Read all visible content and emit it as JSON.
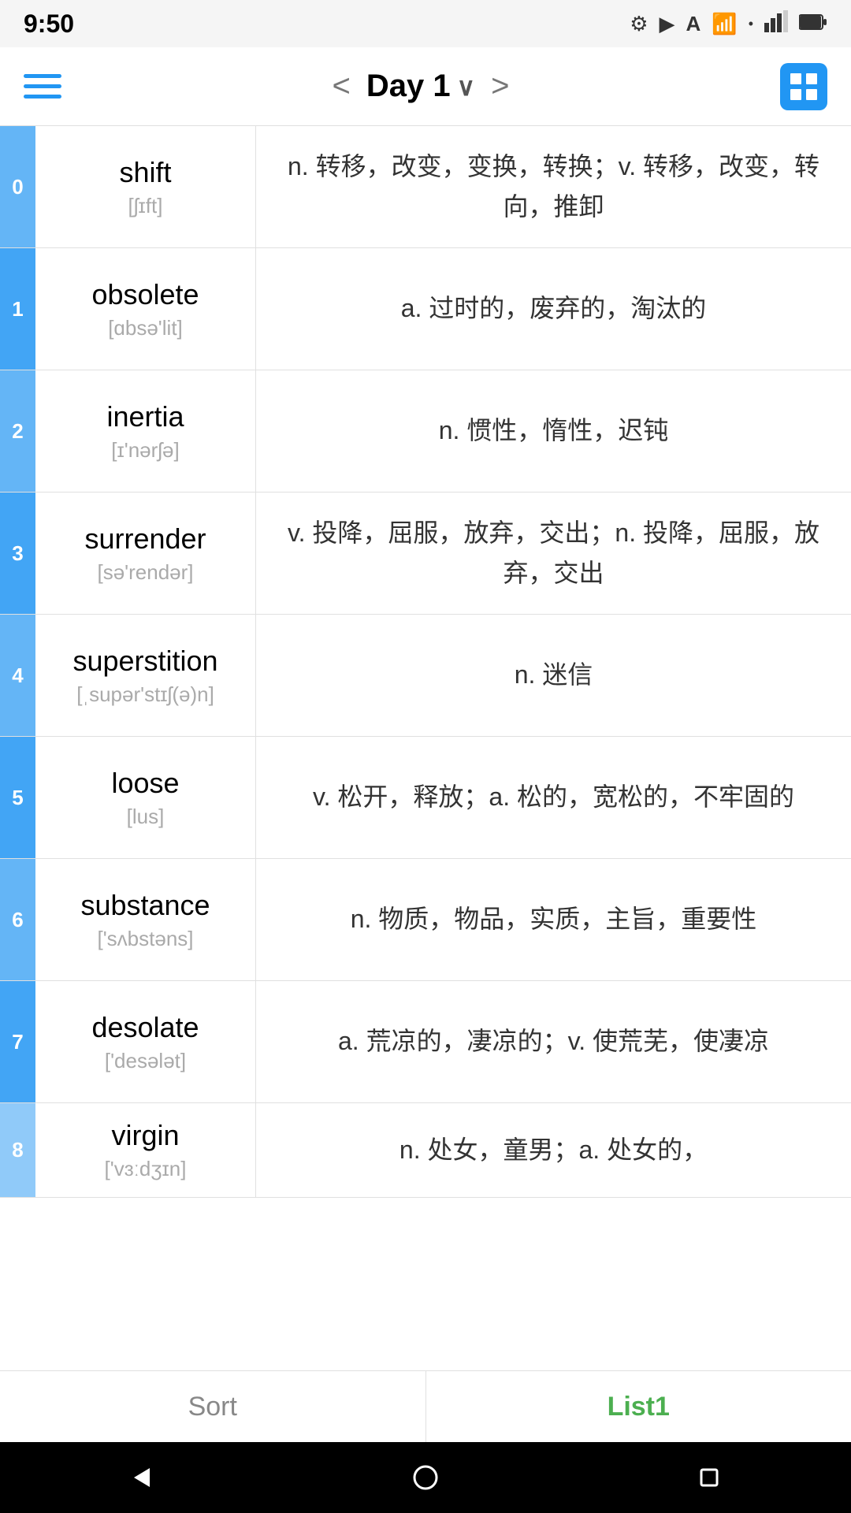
{
  "statusBar": {
    "time": "9:50",
    "icons": [
      "gear",
      "play",
      "A",
      "wifi",
      "signal",
      "battery"
    ]
  },
  "navBar": {
    "title": "Day 1",
    "prevLabel": "<",
    "nextLabel": ">",
    "gridIconAlt": "grid-view"
  },
  "words": [
    {
      "index": "0",
      "english": "shift",
      "phonetic": "[ʃɪft]",
      "definition": "n. 转移，改变，变换，转换；v. 转移，改变，转向，推卸"
    },
    {
      "index": "1",
      "english": "obsolete",
      "phonetic": "[ɑbsə'lit]",
      "definition": "a. 过时的，废弃的，淘汰的"
    },
    {
      "index": "2",
      "english": "inertia",
      "phonetic": "[ɪ'nərʃə]",
      "definition": "n. 惯性，惰性，迟钝"
    },
    {
      "index": "3",
      "english": "surrender",
      "phonetic": "[sə'rendər]",
      "definition": "v. 投降，屈服，放弃，交出；n. 投降，屈服，放弃，交出"
    },
    {
      "index": "4",
      "english": "superstition",
      "phonetic": "[ˌsupər'stɪʃ(ə)n]",
      "definition": "n. 迷信"
    },
    {
      "index": "5",
      "english": "loose",
      "phonetic": "[lus]",
      "definition": "v. 松开，释放；a. 松的，宽松的，不牢固的"
    },
    {
      "index": "6",
      "english": "substance",
      "phonetic": "['sʌbstəns]",
      "definition": "n. 物质，物品，实质，主旨，重要性"
    },
    {
      "index": "7",
      "english": "desolate",
      "phonetic": "['desələt]",
      "definition": "a. 荒凉的，凄凉的；v. 使荒芜，使凄凉"
    },
    {
      "index": "8",
      "english": "virgin",
      "phonetic": "['vɜːdʒɪn]",
      "definition": "n. 处女，童男；a. 处女的，"
    }
  ],
  "bottomTabs": {
    "sort": "Sort",
    "list1": "List1"
  },
  "navButtons": {
    "back": "◀",
    "home": "●",
    "recent": "■"
  }
}
